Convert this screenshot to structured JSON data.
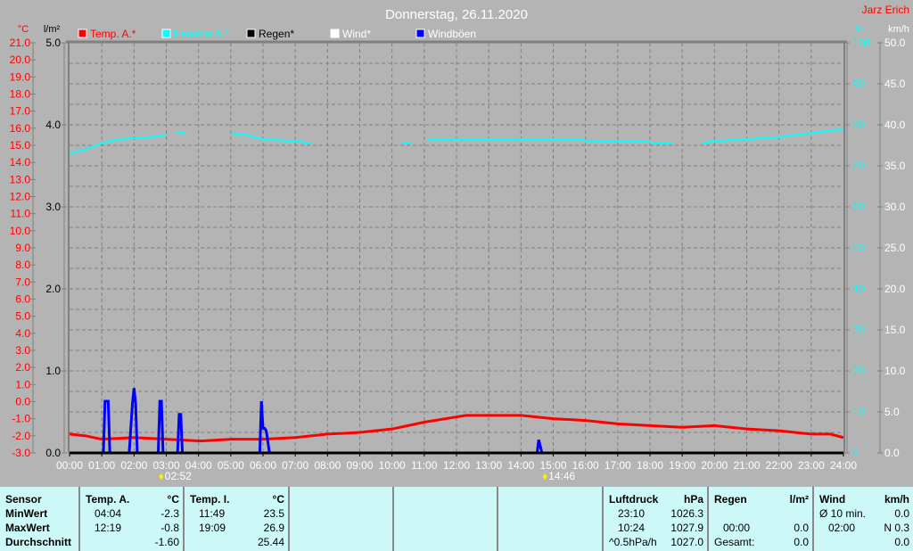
{
  "header": {
    "title": "Donnerstag, 26.11.2020",
    "author": "Jarz Erich"
  },
  "chart_data": {
    "type": "line",
    "title": "Donnerstag, 26.11.2020",
    "x_range": [
      0,
      24
    ],
    "x_ticks": [
      "00:00",
      "01:00",
      "02:00",
      "03:00",
      "04:00",
      "05:00",
      "06:00",
      "07:00",
      "08:00",
      "09:00",
      "10:00",
      "11:00",
      "12:00",
      "13:00",
      "14:00",
      "15:00",
      "16:00",
      "17:00",
      "18:00",
      "19:00",
      "20:00",
      "21:00",
      "22:00",
      "23:00",
      "24:00"
    ],
    "axes": {
      "temp": {
        "unit": "°C",
        "range": [
          -3,
          21
        ],
        "step": 1,
        "color": "#ff0000"
      },
      "rain": {
        "unit": "l/m²",
        "range": [
          0,
          5
        ],
        "step": 1,
        "color": "#000000"
      },
      "humidity": {
        "unit": "%",
        "range": [
          0,
          100
        ],
        "step": 10,
        "color": "#00ffff"
      },
      "wind": {
        "unit": "km/h",
        "range": [
          0,
          50
        ],
        "step": 5,
        "color": "#ffffff"
      }
    },
    "legend": [
      {
        "label": "Temp. A.*",
        "color": "#ff0000",
        "text_color": "#ff0000"
      },
      {
        "label": "Feuchte A.*",
        "color": "#00ffff",
        "text_color": "#00ffff"
      },
      {
        "label": "Regen*",
        "color": "#000000",
        "text_color": "#000000"
      },
      {
        "label": "Wind*",
        "color": "#ffffff",
        "text_color": "#ffffff"
      },
      {
        "label": "Windböen",
        "color": "#0000ff",
        "text_color": "#ffffff"
      }
    ],
    "series": [
      {
        "name": "Temp. A.",
        "axis": "temp",
        "color": "#ff0000",
        "points": [
          [
            0,
            -1.9
          ],
          [
            0.5,
            -2.0
          ],
          [
            1,
            -2.2
          ],
          [
            2,
            -2.1
          ],
          [
            3,
            -2.2
          ],
          [
            4.07,
            -2.3
          ],
          [
            5,
            -2.2
          ],
          [
            6,
            -2.2
          ],
          [
            7,
            -2.1
          ],
          [
            8,
            -1.9
          ],
          [
            9,
            -1.8
          ],
          [
            10,
            -1.6
          ],
          [
            11,
            -1.2
          ],
          [
            12.3,
            -0.8
          ],
          [
            13,
            -0.8
          ],
          [
            14,
            -0.8
          ],
          [
            15,
            -1.0
          ],
          [
            16,
            -1.1
          ],
          [
            17,
            -1.3
          ],
          [
            18,
            -1.4
          ],
          [
            19,
            -1.5
          ],
          [
            20,
            -1.4
          ],
          [
            21,
            -1.6
          ],
          [
            22,
            -1.7
          ],
          [
            23,
            -1.9
          ],
          [
            23.6,
            -1.9
          ],
          [
            24,
            -2.1
          ]
        ]
      },
      {
        "name": "Feuchte A.",
        "axis": "humidity",
        "color": "#00ffff",
        "segments": [
          [
            [
              0,
              73
            ],
            [
              0.5,
              74
            ],
            [
              1,
              75.5
            ],
            [
              1.5,
              76.5
            ],
            [
              2.5,
              77
            ],
            [
              3,
              77.5
            ]
          ],
          [
            [
              3.3,
              78
            ],
            [
              3.6,
              78
            ]
          ],
          [
            [
              5,
              78
            ],
            [
              5.5,
              77.5
            ],
            [
              6,
              76.5
            ],
            [
              7,
              76
            ],
            [
              7.5,
              75.5
            ]
          ],
          [
            [
              10.3,
              75.5
            ],
            [
              10.6,
              75.5
            ]
          ],
          [
            [
              11.1,
              76.5
            ],
            [
              16,
              76.5
            ]
          ],
          [
            [
              16,
              76
            ],
            [
              18,
              76
            ]
          ],
          [
            [
              18,
              75.5
            ],
            [
              18.7,
              75.5
            ]
          ],
          [
            [
              19.6,
              75.5
            ],
            [
              20,
              76
            ],
            [
              21,
              76.5
            ],
            [
              22,
              77
            ],
            [
              23,
              78
            ],
            [
              24,
              79
            ]
          ]
        ]
      },
      {
        "name": "Windböen",
        "axis": "wind",
        "color": "#0000ff",
        "points": [
          [
            0,
            0
          ],
          [
            1.05,
            0
          ],
          [
            1.1,
            6.3
          ],
          [
            1.2,
            6.3
          ],
          [
            1.25,
            0
          ],
          [
            1.85,
            0
          ],
          [
            1.95,
            6
          ],
          [
            2.0,
            7.9
          ],
          [
            2.05,
            6
          ],
          [
            2.1,
            0
          ],
          [
            2.75,
            0
          ],
          [
            2.8,
            6.3
          ],
          [
            2.85,
            6.3
          ],
          [
            2.9,
            0
          ],
          [
            3.35,
            0
          ],
          [
            3.4,
            4.7
          ],
          [
            3.45,
            4.7
          ],
          [
            3.5,
            0
          ],
          [
            5.9,
            0
          ],
          [
            5.95,
            6.3
          ],
          [
            6.0,
            3
          ],
          [
            6.05,
            3
          ],
          [
            6.1,
            2.7
          ],
          [
            6.2,
            0
          ],
          [
            14.5,
            0
          ],
          [
            14.55,
            1.6
          ],
          [
            14.65,
            0
          ],
          [
            24,
            0
          ]
        ]
      },
      {
        "name": "Regen",
        "axis": "rain",
        "color": "#000000",
        "points": [
          [
            0,
            0
          ],
          [
            24,
            0
          ]
        ]
      }
    ],
    "annotations": [
      {
        "x": 2.87,
        "label": "02:52"
      },
      {
        "x": 14.77,
        "label": "14:46"
      }
    ]
  },
  "table": {
    "temp_a": {
      "h1": "Sensor",
      "h2": "Temp. A.",
      "h3": "°C",
      "r1": "MinWert",
      "r2": "MaxWert",
      "r3": "Durchschnitt",
      "min_t": "04:04",
      "min_v": "-2.3",
      "max_t": "12:19",
      "max_v": "-0.8",
      "avg": "-1.60"
    },
    "temp_i": {
      "h": "Temp. I.",
      "u": "°C",
      "min_t": "11:49",
      "min_v": "23.5",
      "max_t": "19:09",
      "max_v": "26.9",
      "avg": "25.44"
    },
    "pressure": {
      "h": "Luftdruck",
      "u": "hPa",
      "min_t": "23:10",
      "min_v": "1026.3",
      "max_t": "10:24",
      "max_v": "1027.9",
      "trend": "^0.5hPa/h",
      "avg": "1027.0"
    },
    "rain": {
      "h": "Regen",
      "u": "l/m²",
      "t": "00:00",
      "v": "0.0",
      "total_l": "Gesamt:",
      "total": "0.0"
    },
    "wind": {
      "h": "Wind",
      "u": "km/h",
      "avg_l": "Ø 10 min.",
      "avg": "0.0",
      "max_t": "02:00",
      "max_v": "N 0.3",
      "v3": "0.0"
    }
  }
}
